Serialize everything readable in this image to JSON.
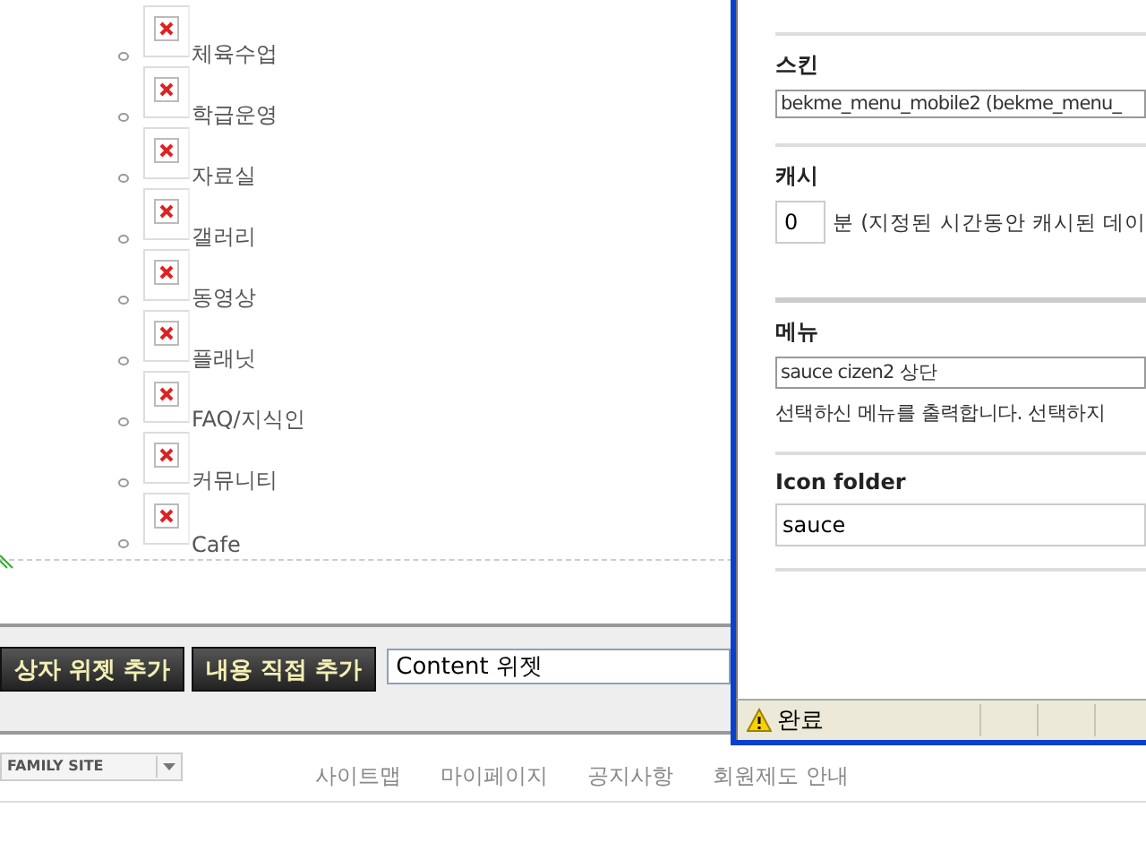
{
  "page": {
    "menu_items": [
      {
        "label": "체육수업"
      },
      {
        "label": "학급운영"
      },
      {
        "label": "자료실"
      },
      {
        "label": "갤러리"
      },
      {
        "label": "동영상"
      },
      {
        "label": "플래닛"
      },
      {
        "label": "FAQ/지식인"
      },
      {
        "label": "커뮤니티"
      },
      {
        "label": "Cafe"
      }
    ],
    "buttons": [
      "상자 위젯 추가",
      "내용 직접 추가"
    ],
    "widget_field": {
      "value": "Content 위젯"
    },
    "family_site": "FAMILY SITE",
    "footer_links": [
      "사이트맵",
      "마이페이지",
      "공지사항",
      "회원제도 안내"
    ]
  },
  "popup": {
    "sections": [
      {
        "kind": "select",
        "label": "스킨",
        "value": "bekme_menu_mobile2 (bekme_menu_"
      },
      {
        "kind": "number",
        "label": "캐시",
        "value": "0",
        "note": "분 (지정된 시간동안 캐시된 데이"
      },
      {
        "kind": "select",
        "label": "메뉴",
        "value": "sauce cizen2 상단",
        "description": "선택하신 메뉴를 출력합니다. 선택하지"
      },
      {
        "kind": "text",
        "label": "Icon folder",
        "value": "sauce"
      }
    ],
    "status_text": "완료"
  }
}
